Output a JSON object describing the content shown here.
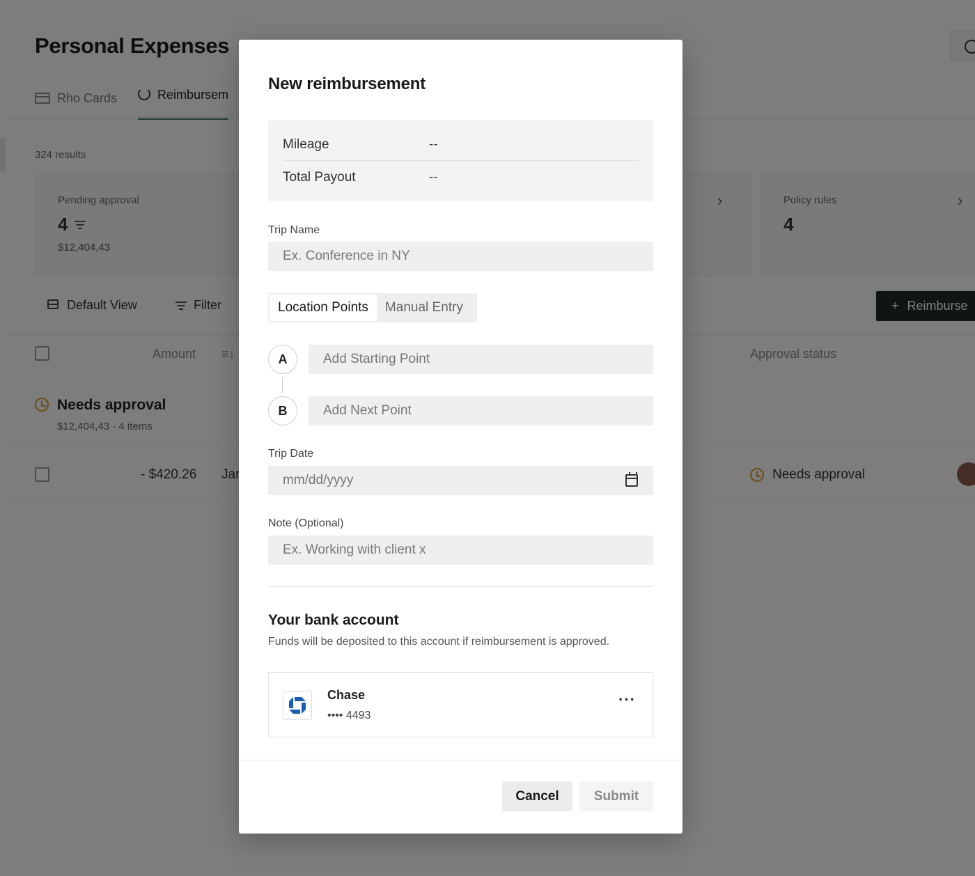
{
  "background": {
    "page_title": "Personal Expenses",
    "tabs": [
      {
        "label": "Rho Cards",
        "icon": "card-icon"
      },
      {
        "label": "Reimbursem",
        "icon": "refresh-icon"
      }
    ],
    "results_count": "324 results",
    "stats": [
      {
        "label": "Pending approval",
        "value": "4",
        "amount": "$12,404,43"
      },
      {
        "label": "Policy rules",
        "value": "4"
      }
    ],
    "toolbar": {
      "default_view": "Default View",
      "filter": "Filter",
      "new_button": "Reimburse"
    },
    "table": {
      "headers": {
        "amount": "Amount",
        "approval_status": "Approval status"
      },
      "group": {
        "title": "Needs approval",
        "subtitle": "$12,404,43 · 4 items"
      },
      "rows": [
        {
          "amount": "- $420.26",
          "date": "Jar",
          "status": "Needs approval"
        }
      ]
    }
  },
  "modal": {
    "title": "New reimbursement",
    "summary": [
      {
        "key": "Mileage",
        "value": "--"
      },
      {
        "key": "Total Payout",
        "value": "--"
      }
    ],
    "trip_name": {
      "label": "Trip Name",
      "placeholder": "Ex. Conference in NY"
    },
    "mode_tabs": [
      {
        "label": "Location Points",
        "active": true
      },
      {
        "label": "Manual Entry",
        "active": false
      }
    ],
    "points": [
      {
        "marker": "A",
        "placeholder": "Add Starting Point"
      },
      {
        "marker": "B",
        "placeholder": "Add Next Point"
      }
    ],
    "trip_date": {
      "label": "Trip Date",
      "placeholder": "mm/dd/yyyy"
    },
    "note": {
      "label": "Note (Optional)",
      "placeholder": "Ex. Working with client x"
    },
    "bank": {
      "title": "Your bank account",
      "subtitle": "Funds will be deposited to this account if reimbursement is approved.",
      "name": "Chase",
      "number": "•••• 4493",
      "more": "···"
    },
    "buttons": {
      "cancel": "Cancel",
      "submit": "Submit"
    }
  },
  "colors": {
    "accent": "#2f6b4f",
    "warning": "#d89a2c",
    "chase_blue": "#1a5db5",
    "overlay": "rgba(0,0,0,0.5)"
  }
}
